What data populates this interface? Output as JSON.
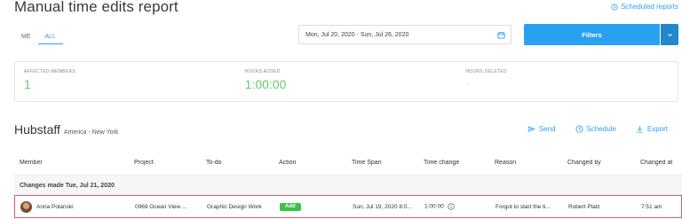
{
  "page": {
    "title": "Manual time edits report",
    "scheduled_reports_label": "Scheduled reports"
  },
  "tabs": [
    {
      "label": "ME",
      "active": false
    },
    {
      "label": "ALL",
      "active": true
    }
  ],
  "date_range": "Mon, Jul 20, 2020 - Sun, Jul 26, 2020",
  "filters_label": "Filters",
  "stats": {
    "affected_members": {
      "label": "AFFECTED MEMBERS",
      "value": "1"
    },
    "hours_added": {
      "label": "HOURS ADDED",
      "value": "1:00:00"
    },
    "hours_deleted": {
      "label": "HOURS DELETED",
      "value": "-"
    }
  },
  "report": {
    "brand": "Hubstaff",
    "timezone": "America - New York",
    "actions": {
      "send": "Send",
      "schedule": "Schedule",
      "export": "Export"
    }
  },
  "table": {
    "headers": [
      "Member",
      "Project",
      "To-do",
      "Action",
      "Time Span",
      "Time change",
      "Reason",
      "Changed by",
      "Changed at"
    ],
    "group_label": "Changes made Tue, Jul 21, 2020",
    "row": {
      "member": "Anna Polanski",
      "project": "0969 Ocean View ...",
      "todo": "Graphic Design Work",
      "action": "Add",
      "time_span": "Sun, Jul 19, 2020 8:0...",
      "time_change": "1:00:00",
      "reason": "Forgot to start the ti...",
      "changed_by": "Robert Platz",
      "changed_at": "7:51 am"
    }
  },
  "colors": {
    "accent": "#2aa0f0",
    "positive": "#6bc76b",
    "add_badge": "#3cc24a",
    "highlight_border": "#d85b6a"
  },
  "icons": {
    "scheduled": "clock-icon",
    "calendar": "calendar-icon",
    "dropdown": "chevron-down-icon",
    "send": "send-icon",
    "schedule": "clock-icon",
    "export": "download-icon",
    "info": "info-icon"
  }
}
